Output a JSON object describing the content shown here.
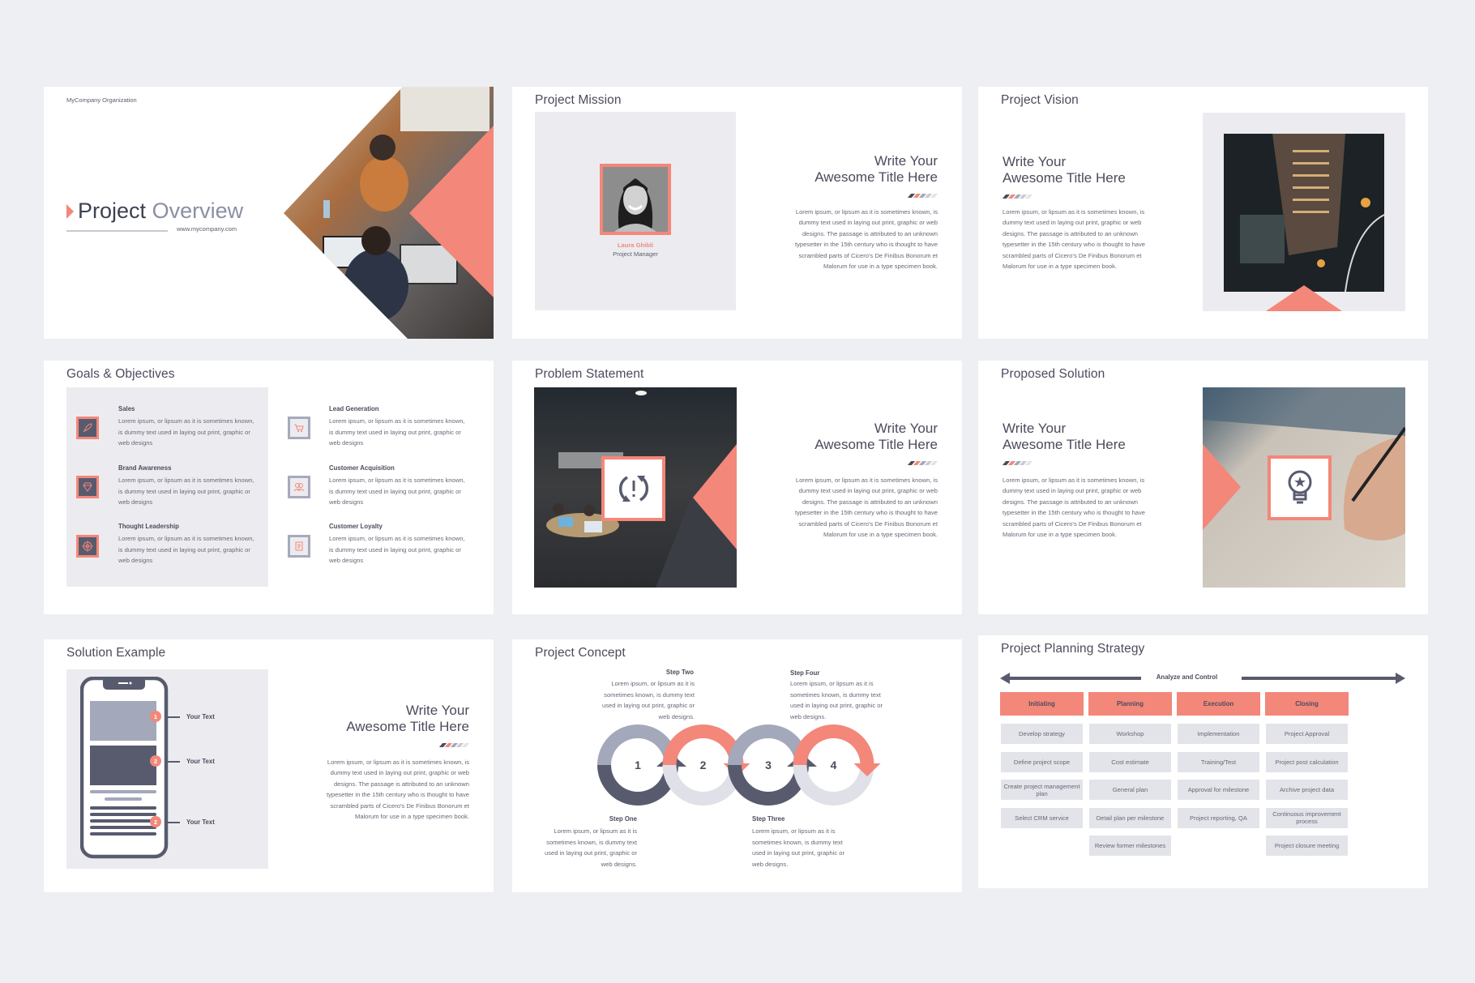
{
  "colors": {
    "accent": "#f3877a",
    "dark": "#585b6e",
    "blue_grey": "#a3a8ba",
    "light_grey": "#dfe0e8",
    "panel": "#ececf0",
    "background": "#eeeff2"
  },
  "stripes": [
    "#4a4c5c",
    "#f3877a",
    "#a3a8ba",
    "#c8cad4",
    "#e2e3ea"
  ],
  "lorem": "Lorem ipsum, or lipsum as it is sometimes known, is dummy text used in laying out print, graphic or web designs. The passage is attributed to an unknown typesetter in the 15th century who is thought to have scrambled parts of Cicero's De Finibus Bonorum et Malorum for use in a type specimen book.",
  "headline": {
    "line1": "Write Your",
    "line2": "Awesome Title Here"
  },
  "slides": {
    "overview": {
      "org": "MyCompany Organization",
      "title_bold": "Project",
      "title_light": "Overview",
      "url": "www.mycompany.com"
    },
    "mission": {
      "title": "Project Mission",
      "person_name": "Laura Ghibli",
      "person_role": "Project Manager"
    },
    "vision": {
      "title": "Project Vision"
    },
    "goals": {
      "title": "Goals & Objectives",
      "items": [
        {
          "title": "Sales",
          "text": "Lorem ipsum, or lipsum as it is sometimes known, is dummy text used in laying out print, graphic or web designs",
          "icon": "rocket-icon"
        },
        {
          "title": "Brand Awareness",
          "text": "Lorem ipsum, or lipsum as it is sometimes known, is dummy text used in laying out print, graphic or web designs",
          "icon": "diamond-icon"
        },
        {
          "title": "Thought Leadership",
          "text": "Lorem ipsum, or lipsum as it is sometimes known, is dummy text used in laying out print, graphic or web designs",
          "icon": "target-icon"
        },
        {
          "title": "Lead Generation",
          "text": "Lorem ipsum, or lipsum as it is sometimes known, is dummy text used in laying out print, graphic or web designs",
          "icon": "cart-icon"
        },
        {
          "title": "Customer Acquisition",
          "text": "Lorem ipsum, or lipsum as it is sometimes known, is dummy text used in laying out print, graphic or web designs",
          "icon": "users-icon"
        },
        {
          "title": "Customer Loyalty",
          "text": "Lorem ipsum, or lipsum as it is sometimes known, is dummy text used in laying out print, graphic or web designs",
          "icon": "receipt-icon"
        }
      ]
    },
    "problem": {
      "title": "Problem Statement",
      "icon": "refresh-alert-icon"
    },
    "solution": {
      "title": "Proposed Solution",
      "icon": "lightbulb-star-icon"
    },
    "example": {
      "title": "Solution Example",
      "callouts": [
        {
          "badge": "1",
          "label": "Your Text"
        },
        {
          "badge": "2",
          "label": "Your Text"
        },
        {
          "badge": "2",
          "label": "Your Text"
        }
      ]
    },
    "concept": {
      "title": "Project Concept",
      "steps": [
        {
          "number": "1",
          "title": "Step One",
          "text": "Lorem ipsum, or lipsum as it is sometimes known, is dummy text used in laying out print, graphic or web designs."
        },
        {
          "number": "2",
          "title": "Step Two",
          "text": "Lorem ipsum, or lipsum as it is sometimes known, is dummy text used in laying out print, graphic or web designs."
        },
        {
          "number": "3",
          "title": "Step Three",
          "text": "Lorem ipsum, or lipsum as it is sometimes known, is dummy text used in laying out print, graphic or web designs."
        },
        {
          "number": "4",
          "title": "Step Four",
          "text": "Lorem ipsum, or lipsum as it is sometimes known, is dummy text used in laying out print, graphic or web designs."
        }
      ]
    },
    "planning": {
      "title": "Project Planning Strategy",
      "arrow_label": "Analyze and Control",
      "phases": [
        {
          "name": "Initiating",
          "items": [
            "Develop strategy",
            "Define project scope",
            "Create project management plan",
            "Select CRM service"
          ]
        },
        {
          "name": "Planning",
          "items": [
            "Workshop",
            "Cost estimate",
            "General plan",
            "Detail plan per milestone",
            "Review former milestones"
          ]
        },
        {
          "name": "Execution",
          "items": [
            "Implementation",
            "Training/Test",
            "Approval for milestone",
            "Project reporting, QA"
          ]
        },
        {
          "name": "Closing",
          "items": [
            "Project Approval",
            "Project post calculation",
            "Archive project data",
            "Continuous improvement process",
            "Project closure meeting"
          ]
        }
      ]
    }
  }
}
